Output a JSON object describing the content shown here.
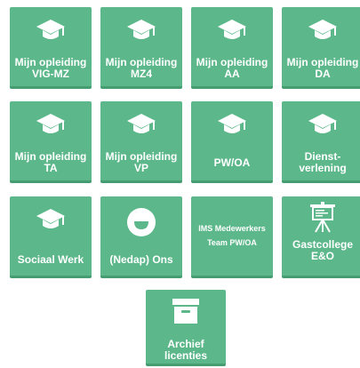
{
  "colors": {
    "tile_background": "#5cb88a",
    "tile_shadow": "#479d72",
    "icon_and_text": "#ffffff"
  },
  "tiles": [
    {
      "name": "mijn-opleiding-vig-mz",
      "icon": "graduation-cap-icon",
      "line1": "Mijn opleiding",
      "line2": "VIG-MZ"
    },
    {
      "name": "mijn-opleiding-mz4",
      "icon": "graduation-cap-icon",
      "line1": "Mijn opleiding",
      "line2": "MZ4"
    },
    {
      "name": "mijn-opleiding-aa",
      "icon": "graduation-cap-icon",
      "line1": "Mijn opleiding",
      "line2": "AA"
    },
    {
      "name": "mijn-opleiding-da",
      "icon": "graduation-cap-icon",
      "line1": "Mijn opleiding",
      "line2": "DA"
    },
    {
      "name": "mijn-opleiding-ta",
      "icon": "graduation-cap-icon",
      "line1": "Mijn opleiding",
      "line2": "TA"
    },
    {
      "name": "mijn-opleiding-vp",
      "icon": "graduation-cap-icon",
      "line1": "Mijn opleiding",
      "line2": "VP"
    },
    {
      "name": "pw-oa",
      "icon": "graduation-cap-icon",
      "line1": "PW/OA",
      "line2": ""
    },
    {
      "name": "dienstverlening",
      "icon": "graduation-cap-icon",
      "line1": "Dienst-",
      "line2": "verlening"
    },
    {
      "name": "sociaal-werk",
      "icon": "graduation-cap-icon",
      "line1": "Sociaal Werk",
      "line2": ""
    },
    {
      "name": "nedap-ons",
      "icon": "smiley-icon",
      "line1": "(Nedap) Ons",
      "line2": ""
    },
    {
      "name": "ims-medewerkers",
      "icon": "",
      "line1": "IMS Medewerkers",
      "line2": "Team PW/OA"
    },
    {
      "name": "gastcollege-eo",
      "icon": "presentation-easel-icon",
      "line1": "Gastcollege",
      "line2": "E&O"
    },
    {
      "name": "archief-licenties",
      "icon": "archive-box-icon",
      "line1": "Archief",
      "line2": "licenties"
    }
  ]
}
